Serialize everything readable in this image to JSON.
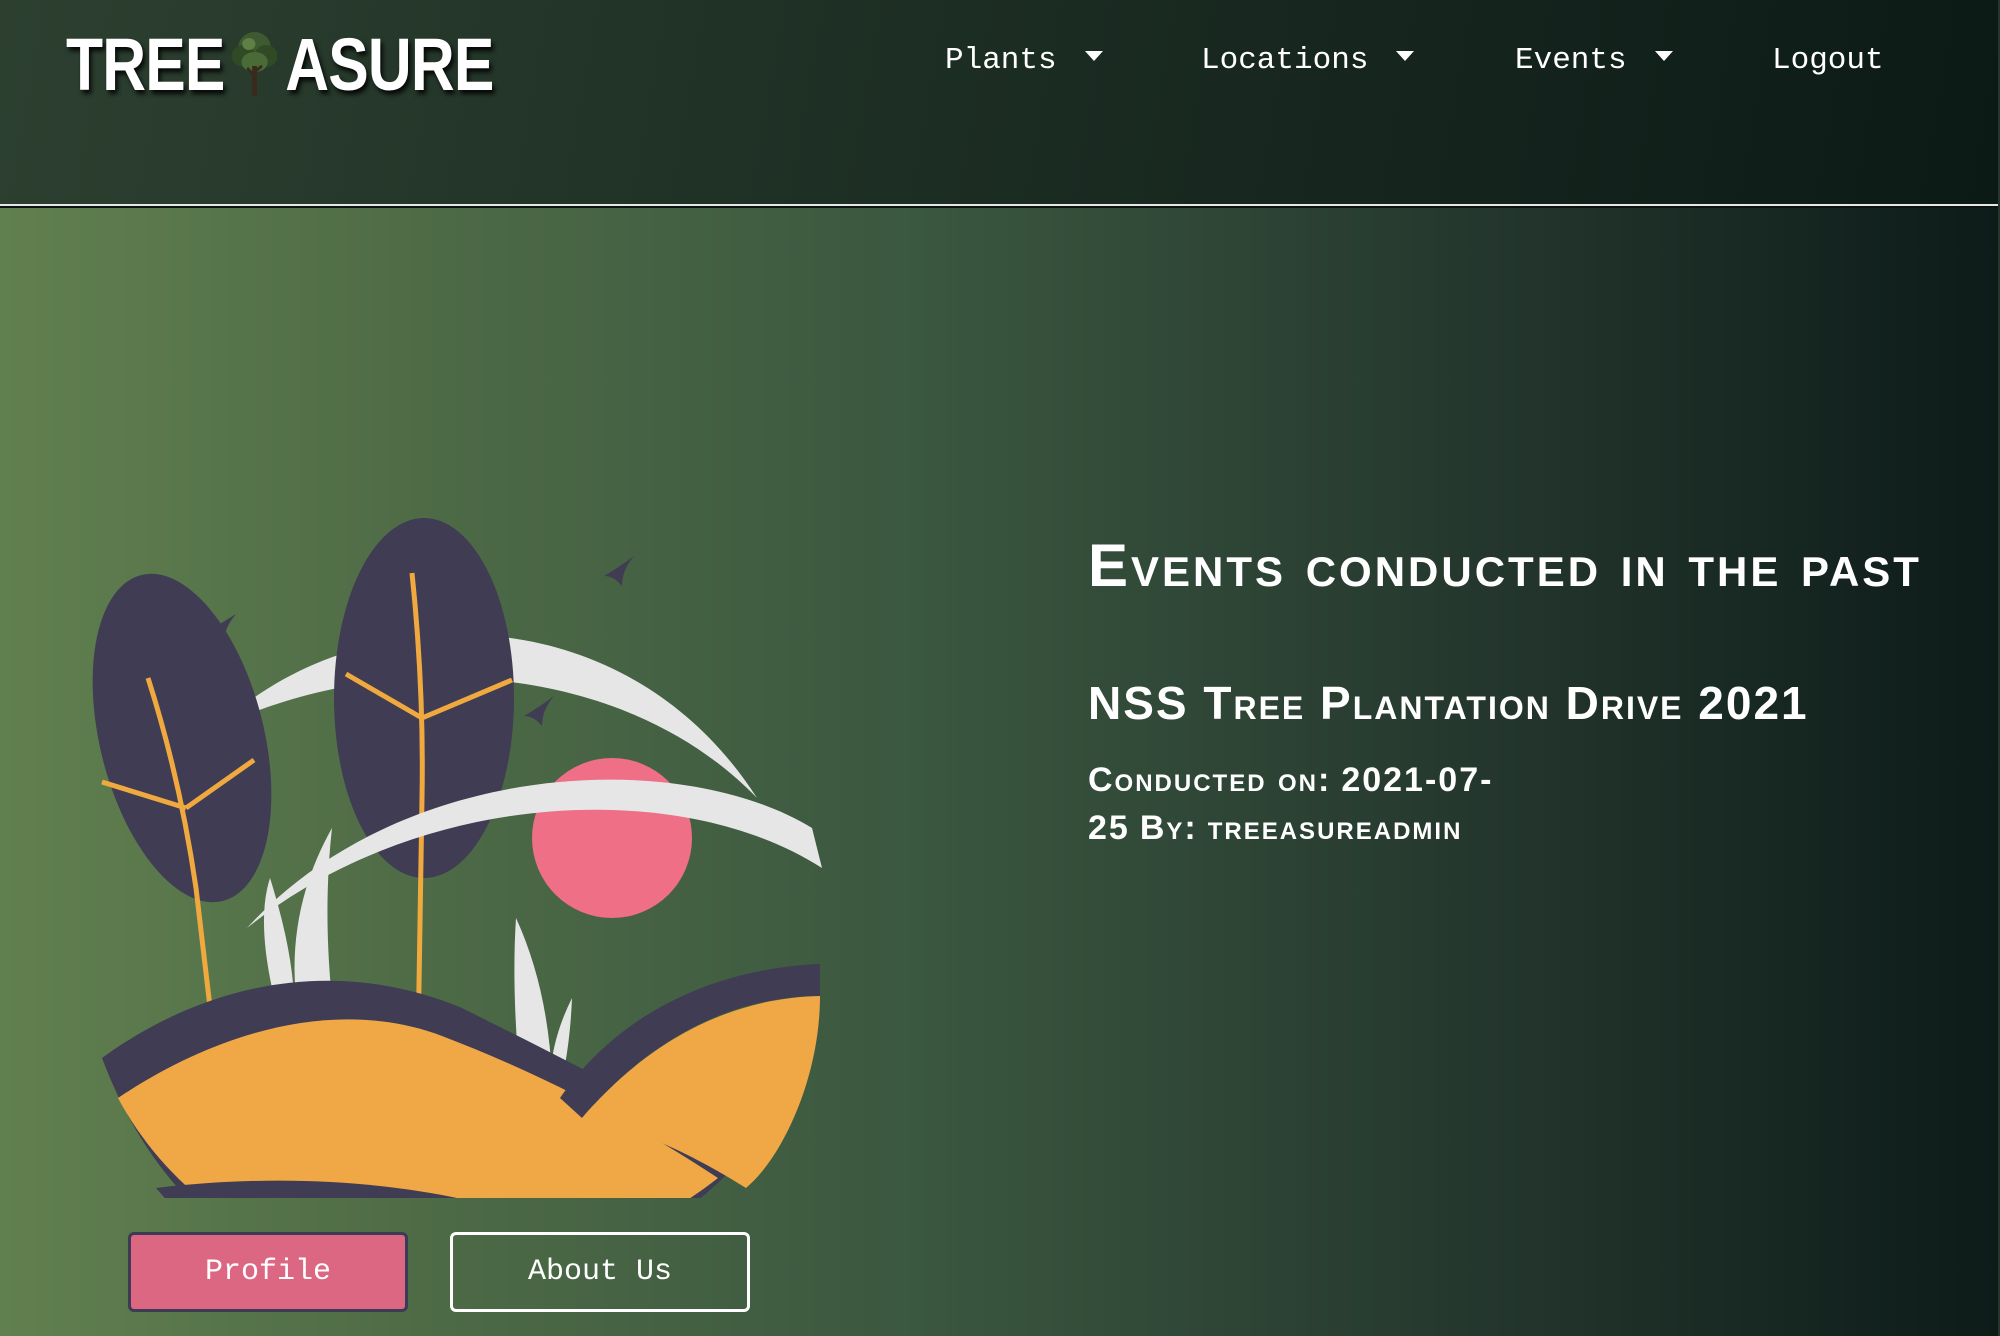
{
  "brand": {
    "name_left": "TREE",
    "name_right": "ASURE",
    "logo_icon": "tree-icon"
  },
  "nav": {
    "items": [
      {
        "label": "Plants",
        "dropdown": true
      },
      {
        "label": "Locations",
        "dropdown": true
      },
      {
        "label": "Events",
        "dropdown": true
      },
      {
        "label": "Logout",
        "dropdown": false
      }
    ]
  },
  "hero": {
    "heading": "Events conducted in the past",
    "event": {
      "title": "NSS Tree Plantation Drive 2021",
      "conducted_label": "Conducted on:",
      "date": "2021-07-25",
      "by_label": "By:",
      "author": "treeasureadmin"
    },
    "buttons": {
      "profile": "Profile",
      "about": "About Us"
    }
  },
  "colors": {
    "accent_pink": "#dc6782",
    "tree_dark": "#3f3c54",
    "hill_orange": "#efa845",
    "branch": "#f0a93e",
    "leaf_light": "#e6e6e6",
    "sun": "#ee6f86"
  }
}
